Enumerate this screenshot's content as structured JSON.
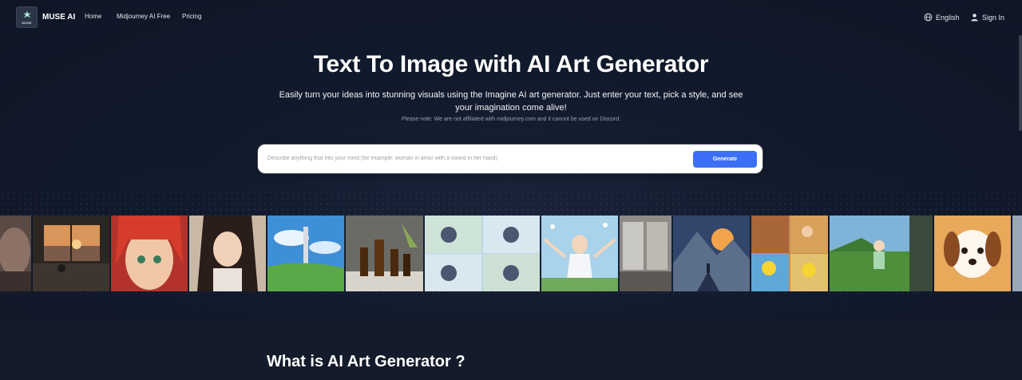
{
  "header": {
    "brand": "MUSE AI",
    "logo_mini_text": "MUSE",
    "nav": [
      "Home",
      "Midjourney AI Free",
      "Pricing"
    ],
    "language": "English",
    "signin": "Sign In"
  },
  "hero": {
    "title": "Text To Image with AI Art Generator",
    "subtitle": "Easily turn your ideas into stunning visuals using the Imagine AI art generator. Just enter your text, pick a style, and see your imagination come alive!",
    "note": "Please note: We are not affiliated with midjourney.com and it cannot be used on Discord."
  },
  "search": {
    "placeholder": "Describe anything that hits your mind (for example: woman in amor with a sword in her hand)",
    "value": "",
    "button": "Generate"
  },
  "gallery": {
    "items": [
      "partial-portrait",
      "sunset-window-room",
      "anime-red-hair-girl",
      "anime-dark-hair-girl",
      "rocket-meadow",
      "oil-bottles-still-life",
      "anime-cat-girls-grid",
      "anime-boy-flowers",
      "modern-interior",
      "mountain-hiker-sunset",
      "pikachu-grid",
      "anime-boy-running",
      "cartoon-dog",
      "partial-edge"
    ]
  },
  "section": {
    "title": "What is AI Art Generator ?"
  },
  "colors": {
    "background": "#111827",
    "accent": "#3b6ff5"
  }
}
